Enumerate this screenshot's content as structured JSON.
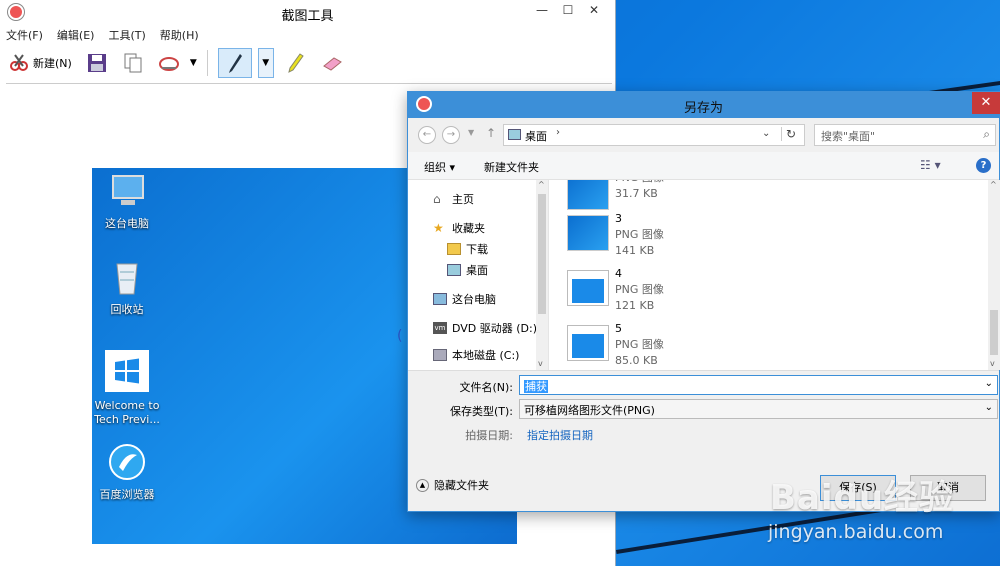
{
  "snipping_tool": {
    "title": "截图工具",
    "window_controls": {
      "minimize": "—",
      "maximize": "☐",
      "close": "✕"
    },
    "menu": [
      "文件(F)",
      "编辑(E)",
      "工具(T)",
      "帮助(H)"
    ],
    "toolbar": {
      "new_label": "新建(N)"
    }
  },
  "desktop_icons": [
    {
      "label": "这台电脑",
      "icon": "computer-icon"
    },
    {
      "label": "回收站",
      "icon": "recycle-bin-icon"
    },
    {
      "label": "Welcome to Tech Previ...",
      "icon": "windows-logo-icon"
    },
    {
      "label": "百度浏览器",
      "icon": "baidu-browser-icon"
    }
  ],
  "dialog": {
    "title": "另存为",
    "address": {
      "location": "桌面",
      "search_placeholder": "搜索\"桌面\""
    },
    "commands": {
      "organize": "组织 ▾",
      "new_folder": "新建文件夹"
    },
    "nav": [
      {
        "label": "主页",
        "icon": "home-icon"
      },
      {
        "label": "收藏夹",
        "icon": "star-icon"
      },
      {
        "label": "下载",
        "icon": "download-folder-icon"
      },
      {
        "label": "桌面",
        "icon": "desktop-folder-icon"
      },
      {
        "label": "这台电脑",
        "icon": "computer-icon"
      },
      {
        "label": "DVD 驱动器 (D:)",
        "icon": "dvd-drive-icon"
      },
      {
        "label": "本地磁盘 (C:)",
        "icon": "disk-icon"
      }
    ],
    "files": [
      {
        "name": "",
        "type": "PNG 图像",
        "size": "31.7 KB"
      },
      {
        "name": "3",
        "type": "PNG 图像",
        "size": "141 KB"
      },
      {
        "name": "4",
        "type": "PNG 图像",
        "size": "121 KB"
      },
      {
        "name": "5",
        "type": "PNG 图像",
        "size": "85.0 KB"
      }
    ],
    "form": {
      "filename_label": "文件名(N):",
      "filename_value": "捕获",
      "filetype_label": "保存类型(T):",
      "filetype_value": "可移植网络图形文件(PNG)",
      "date_label": "拍摄日期:",
      "date_value": "指定拍摄日期"
    },
    "hide_folders": "隐藏文件夹",
    "save_button": "保存(S)",
    "cancel_button": "取消"
  },
  "watermark": {
    "brand": "Baidu经验",
    "url": "jingyan.baidu.com"
  },
  "colors": {
    "accent": "#3c8fd8",
    "close_red": "#c73a3a",
    "link": "#1565c0"
  }
}
